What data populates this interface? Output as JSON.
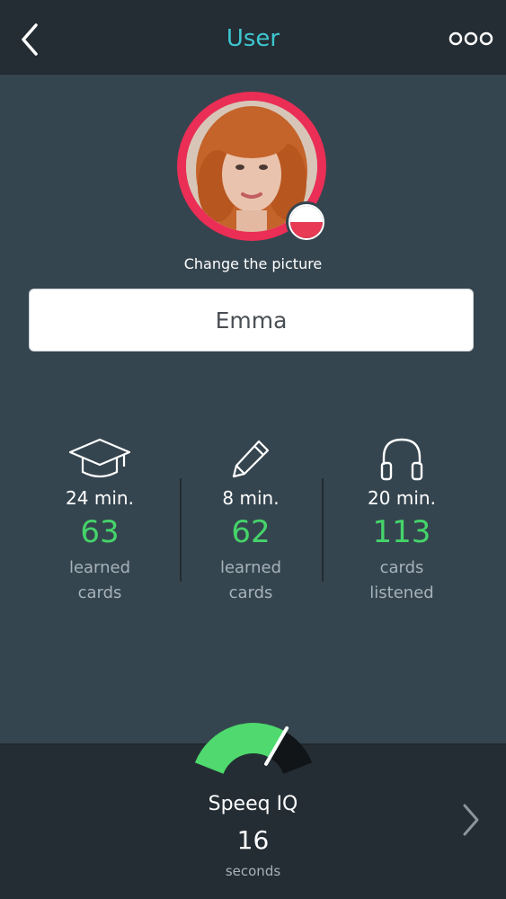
{
  "header": {
    "title": "User",
    "back_icon": "chevron-left-icon",
    "menu_icon": "more-dots-icon"
  },
  "profile": {
    "change_picture_label": "Change the picture",
    "name_value": "Emma",
    "language_flag": "poland-flag-icon"
  },
  "stats": [
    {
      "icon": "graduation-cap-icon",
      "time": "24 min.",
      "count": "63",
      "label_line1": "learned",
      "label_line2": "cards"
    },
    {
      "icon": "pencil-icon",
      "time": "8 min.",
      "count": "62",
      "label_line1": "learned",
      "label_line2": "cards"
    },
    {
      "icon": "headphones-icon",
      "time": "20 min.",
      "count": "113",
      "label_line1": "cards",
      "label_line2": "listened"
    }
  ],
  "speeq_iq": {
    "title": "Speeq IQ",
    "value": "16",
    "unit": "seconds",
    "gauge_level": 0.72,
    "next_icon": "chevron-right-icon"
  },
  "colors": {
    "accent_title": "#3ec6cf",
    "count_green": "#45d46a",
    "avatar_ring": "#ea2e55",
    "background": "#35454f",
    "bars": "#242d34"
  }
}
